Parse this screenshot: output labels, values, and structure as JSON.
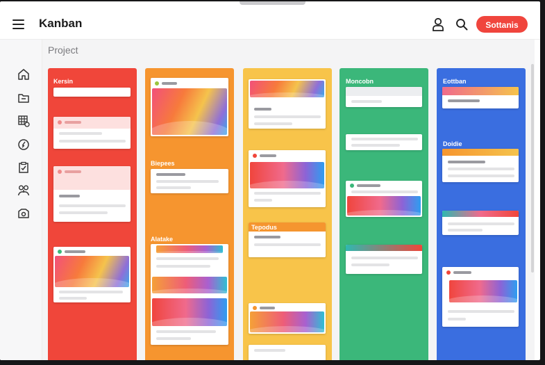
{
  "header": {
    "app_title": "Kanban",
    "settings_label": "Sottanis",
    "menu_icon": "hamburger-menu-icon",
    "user_icon": "user-icon",
    "search_icon": "search-icon"
  },
  "sidebar": {
    "items": [
      {
        "icon": "home-icon"
      },
      {
        "icon": "folder-icon"
      },
      {
        "icon": "calendar-grid-icon"
      },
      {
        "icon": "compass-icon"
      },
      {
        "icon": "checklist-icon"
      },
      {
        "icon": "team-icon"
      },
      {
        "icon": "camera-icon"
      }
    ]
  },
  "content": {
    "section_label": "Project"
  },
  "columns": [
    {
      "title": "Kersin",
      "color": "#f0463a"
    },
    {
      "title": "",
      "color": "#f6952f",
      "group_labels": [
        "Biepees",
        "Alatake"
      ]
    },
    {
      "title": "",
      "color": "#f8c44a",
      "group_labels": [
        "Tepodus"
      ]
    },
    {
      "title": "Moncobn",
      "color": "#3bb77a"
    },
    {
      "title": "Eottban",
      "color": "#3a6ee0",
      "group_labels": [
        "Doidie"
      ]
    }
  ],
  "colors": {
    "accent": "#f0453d",
    "red": "#f0463a",
    "orange": "#f6952f",
    "yellow": "#f8c44a",
    "green": "#3bb77a",
    "blue": "#3a6ee0"
  }
}
